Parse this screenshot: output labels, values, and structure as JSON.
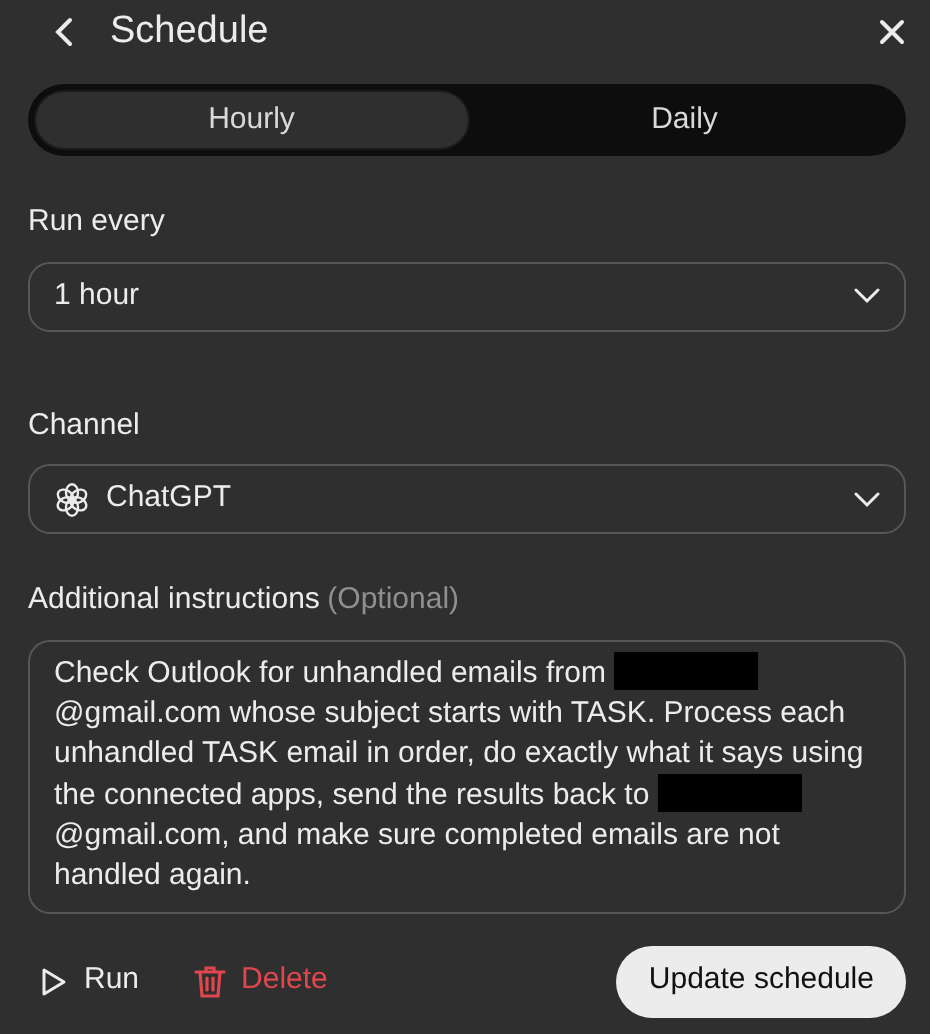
{
  "header": {
    "title": "Schedule"
  },
  "tabs": [
    {
      "label": "Hourly",
      "selected": true
    },
    {
      "label": "Daily",
      "selected": false
    }
  ],
  "run_every": {
    "label": "Run every",
    "value": "1 hour"
  },
  "channel": {
    "label": "Channel",
    "value": "ChatGPT"
  },
  "instructions": {
    "label": "Additional instructions",
    "hint": "(Optional)",
    "segments": [
      {
        "kind": "text",
        "text": "Check Outlook for unhandled emails from "
      },
      {
        "kind": "redacted"
      },
      {
        "kind": "text",
        "text": "@gmail.com whose subject starts with TASK. Process each unhandled TASK email in order, do exactly what it says using the connected apps, send the results back to "
      },
      {
        "kind": "redacted"
      },
      {
        "kind": "text",
        "text": "@gmail.com, and make sure completed emails are not handled again."
      }
    ]
  },
  "actions": {
    "run": "Run",
    "delete": "Delete",
    "update": "Update schedule"
  }
}
